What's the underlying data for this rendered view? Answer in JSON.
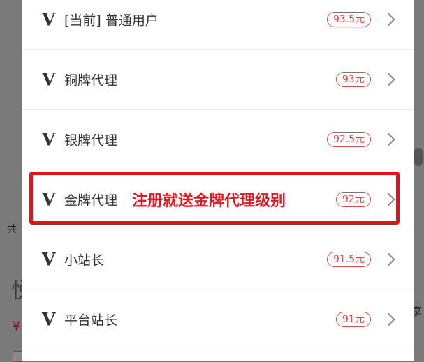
{
  "background": {
    "left_fragment_1": "共",
    "left_fragment_2": "悦",
    "left_fragment_3": "¥",
    "right_fragment": "享"
  },
  "levels": [
    {
      "icon": "V",
      "label": "[当前] 普通用户",
      "price": "93.5元"
    },
    {
      "icon": "V",
      "label": "铜牌代理",
      "price": "93元"
    },
    {
      "icon": "V",
      "label": "银牌代理",
      "price": "92.5元"
    },
    {
      "icon": "V",
      "label": "金牌代理",
      "price": "92元"
    },
    {
      "icon": "V",
      "label": "小站长",
      "price": "91.5元"
    },
    {
      "icon": "V",
      "label": "平台站长",
      "price": "91元"
    }
  ],
  "annotation": {
    "text": "注册就送金牌代理级别",
    "color": "#e0121c"
  },
  "colors": {
    "price_accent": "#e04848",
    "sheet_background": "#ffffff",
    "overlay": "#7a7a7a"
  }
}
